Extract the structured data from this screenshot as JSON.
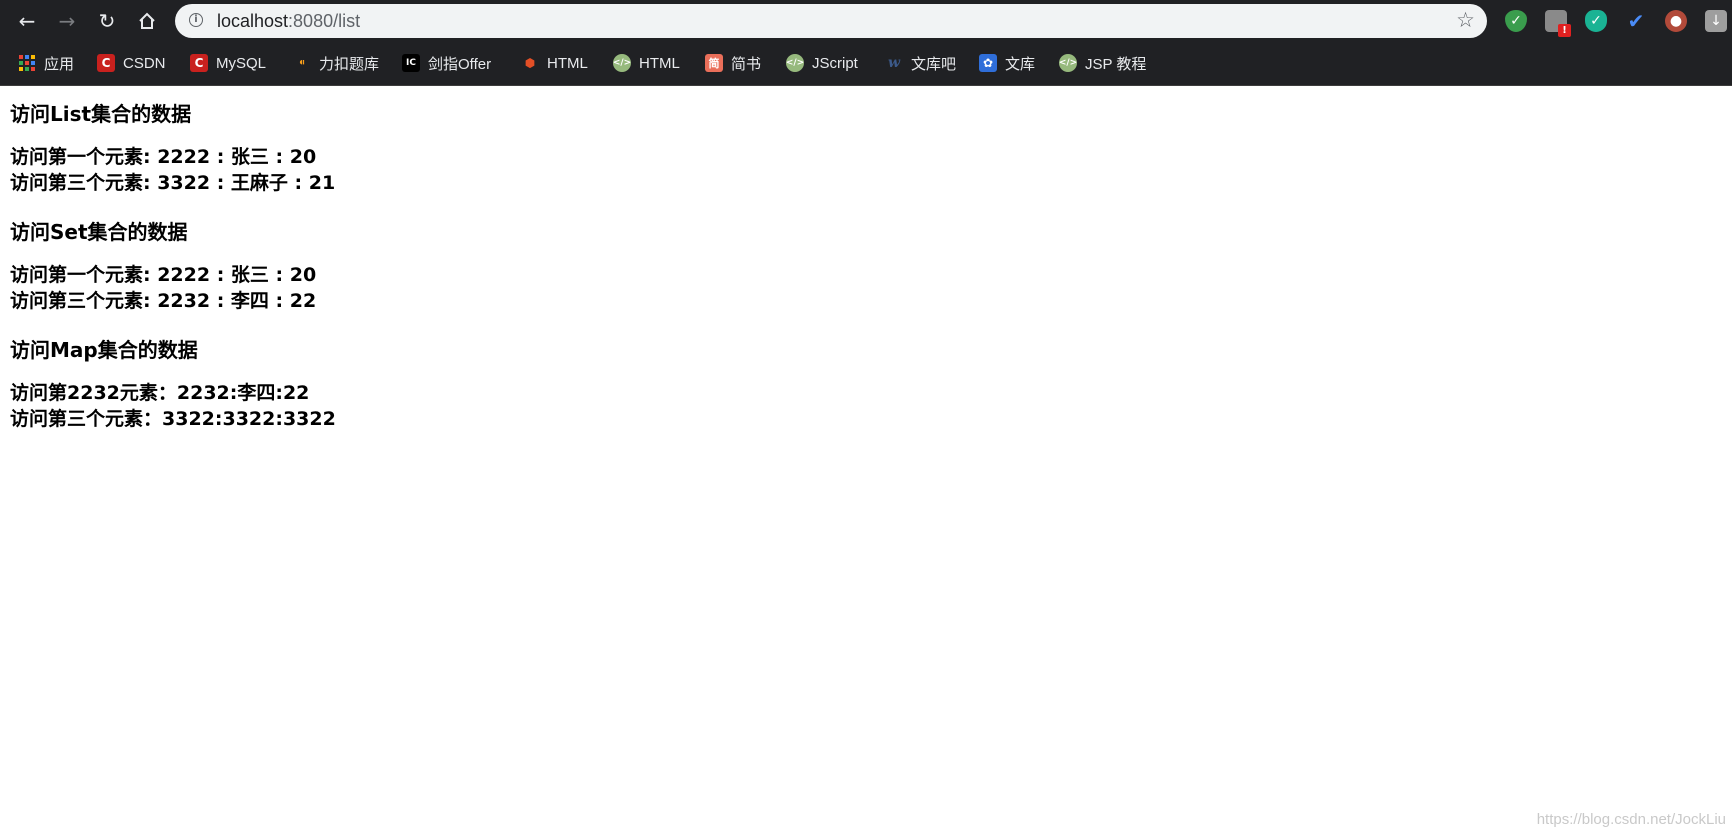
{
  "browser": {
    "url_host": "localhost",
    "url_path": ":8080/list",
    "bookmarks": [
      {
        "label": "应用",
        "icon": "apps-grid-icon"
      },
      {
        "label": "CSDN",
        "icon": "csdn-icon"
      },
      {
        "label": "MySQL",
        "icon": "csdn-icon"
      },
      {
        "label": "力扣题库",
        "icon": "leetcode-icon"
      },
      {
        "label": "剑指Offer",
        "icon": "offer-icon"
      },
      {
        "label": "HTML",
        "icon": "html5-icon"
      },
      {
        "label": "HTML",
        "icon": "runoob-icon"
      },
      {
        "label": "简书",
        "icon": "jianshu-icon"
      },
      {
        "label": "JScript",
        "icon": "runoob-icon"
      },
      {
        "label": "文库吧",
        "icon": "wenkuba-icon"
      },
      {
        "label": "文库",
        "icon": "baidu-icon"
      },
      {
        "label": "JSP 教程",
        "icon": "runoob-icon"
      }
    ],
    "extensions": [
      "shield-green-icon",
      "extension-alert-icon",
      "shield-check-icon",
      "check-circle-icon",
      "glasses-face-icon",
      "download-icon"
    ],
    "alert_badge": "!"
  },
  "page": {
    "sections": [
      {
        "title": "访问List集合的数据",
        "rows": [
          "访问第一个元素: 2222 : 张三 : 20",
          "访问第三个元素: 3322 : 王麻子 : 21"
        ]
      },
      {
        "title": "访问Set集合的数据",
        "rows": [
          "访问第一个元素: 2222 : 张三 : 20",
          "访问第三个元素: 2232 : 李四 : 22"
        ]
      },
      {
        "title": "访问Map集合的数据",
        "rows": [
          "访问第2232元素：2232:李四:22",
          "访问第三个元素：3322:3322:3322"
        ]
      }
    ],
    "watermark": "https://blog.csdn.net/JockLiu"
  },
  "colors": {
    "toolbar_bg": "#202124",
    "omnibox_bg": "#f1f3f4",
    "csdn_red": "#c9211e",
    "runoob_green": "#96b97d"
  }
}
